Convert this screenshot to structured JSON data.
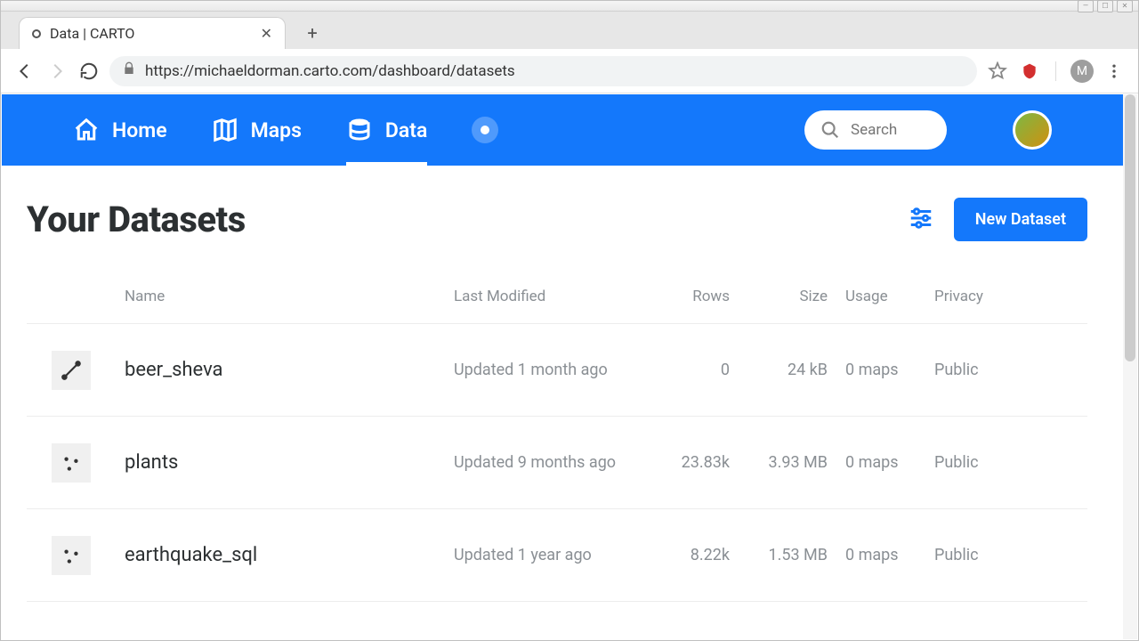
{
  "browser": {
    "tab_title": "Data | CARTO",
    "url": "https://michaeldorman.carto.com/dashboard/datasets",
    "avatar_letter": "M"
  },
  "nav": {
    "home": "Home",
    "maps": "Maps",
    "data": "Data",
    "search_placeholder": "Search"
  },
  "page": {
    "title": "Your Datasets",
    "new_button": "New Dataset",
    "columns": {
      "name": "Name",
      "last_modified": "Last Modified",
      "rows": "Rows",
      "size": "Size",
      "usage": "Usage",
      "privacy": "Privacy"
    },
    "rows": [
      {
        "icon": "line",
        "name": "beer_sheva",
        "modified": "Updated 1 month ago",
        "rows": "0",
        "size": "24 kB",
        "usage": "0 maps",
        "privacy": "Public"
      },
      {
        "icon": "dots",
        "name": "plants",
        "modified": "Updated 9 months ago",
        "rows": "23.83k",
        "size": "3.93 MB",
        "usage": "0 maps",
        "privacy": "Public"
      },
      {
        "icon": "dots",
        "name": "earthquake_sql",
        "modified": "Updated 1 year ago",
        "rows": "8.22k",
        "size": "1.53 MB",
        "usage": "0 maps",
        "privacy": "Public"
      }
    ]
  }
}
